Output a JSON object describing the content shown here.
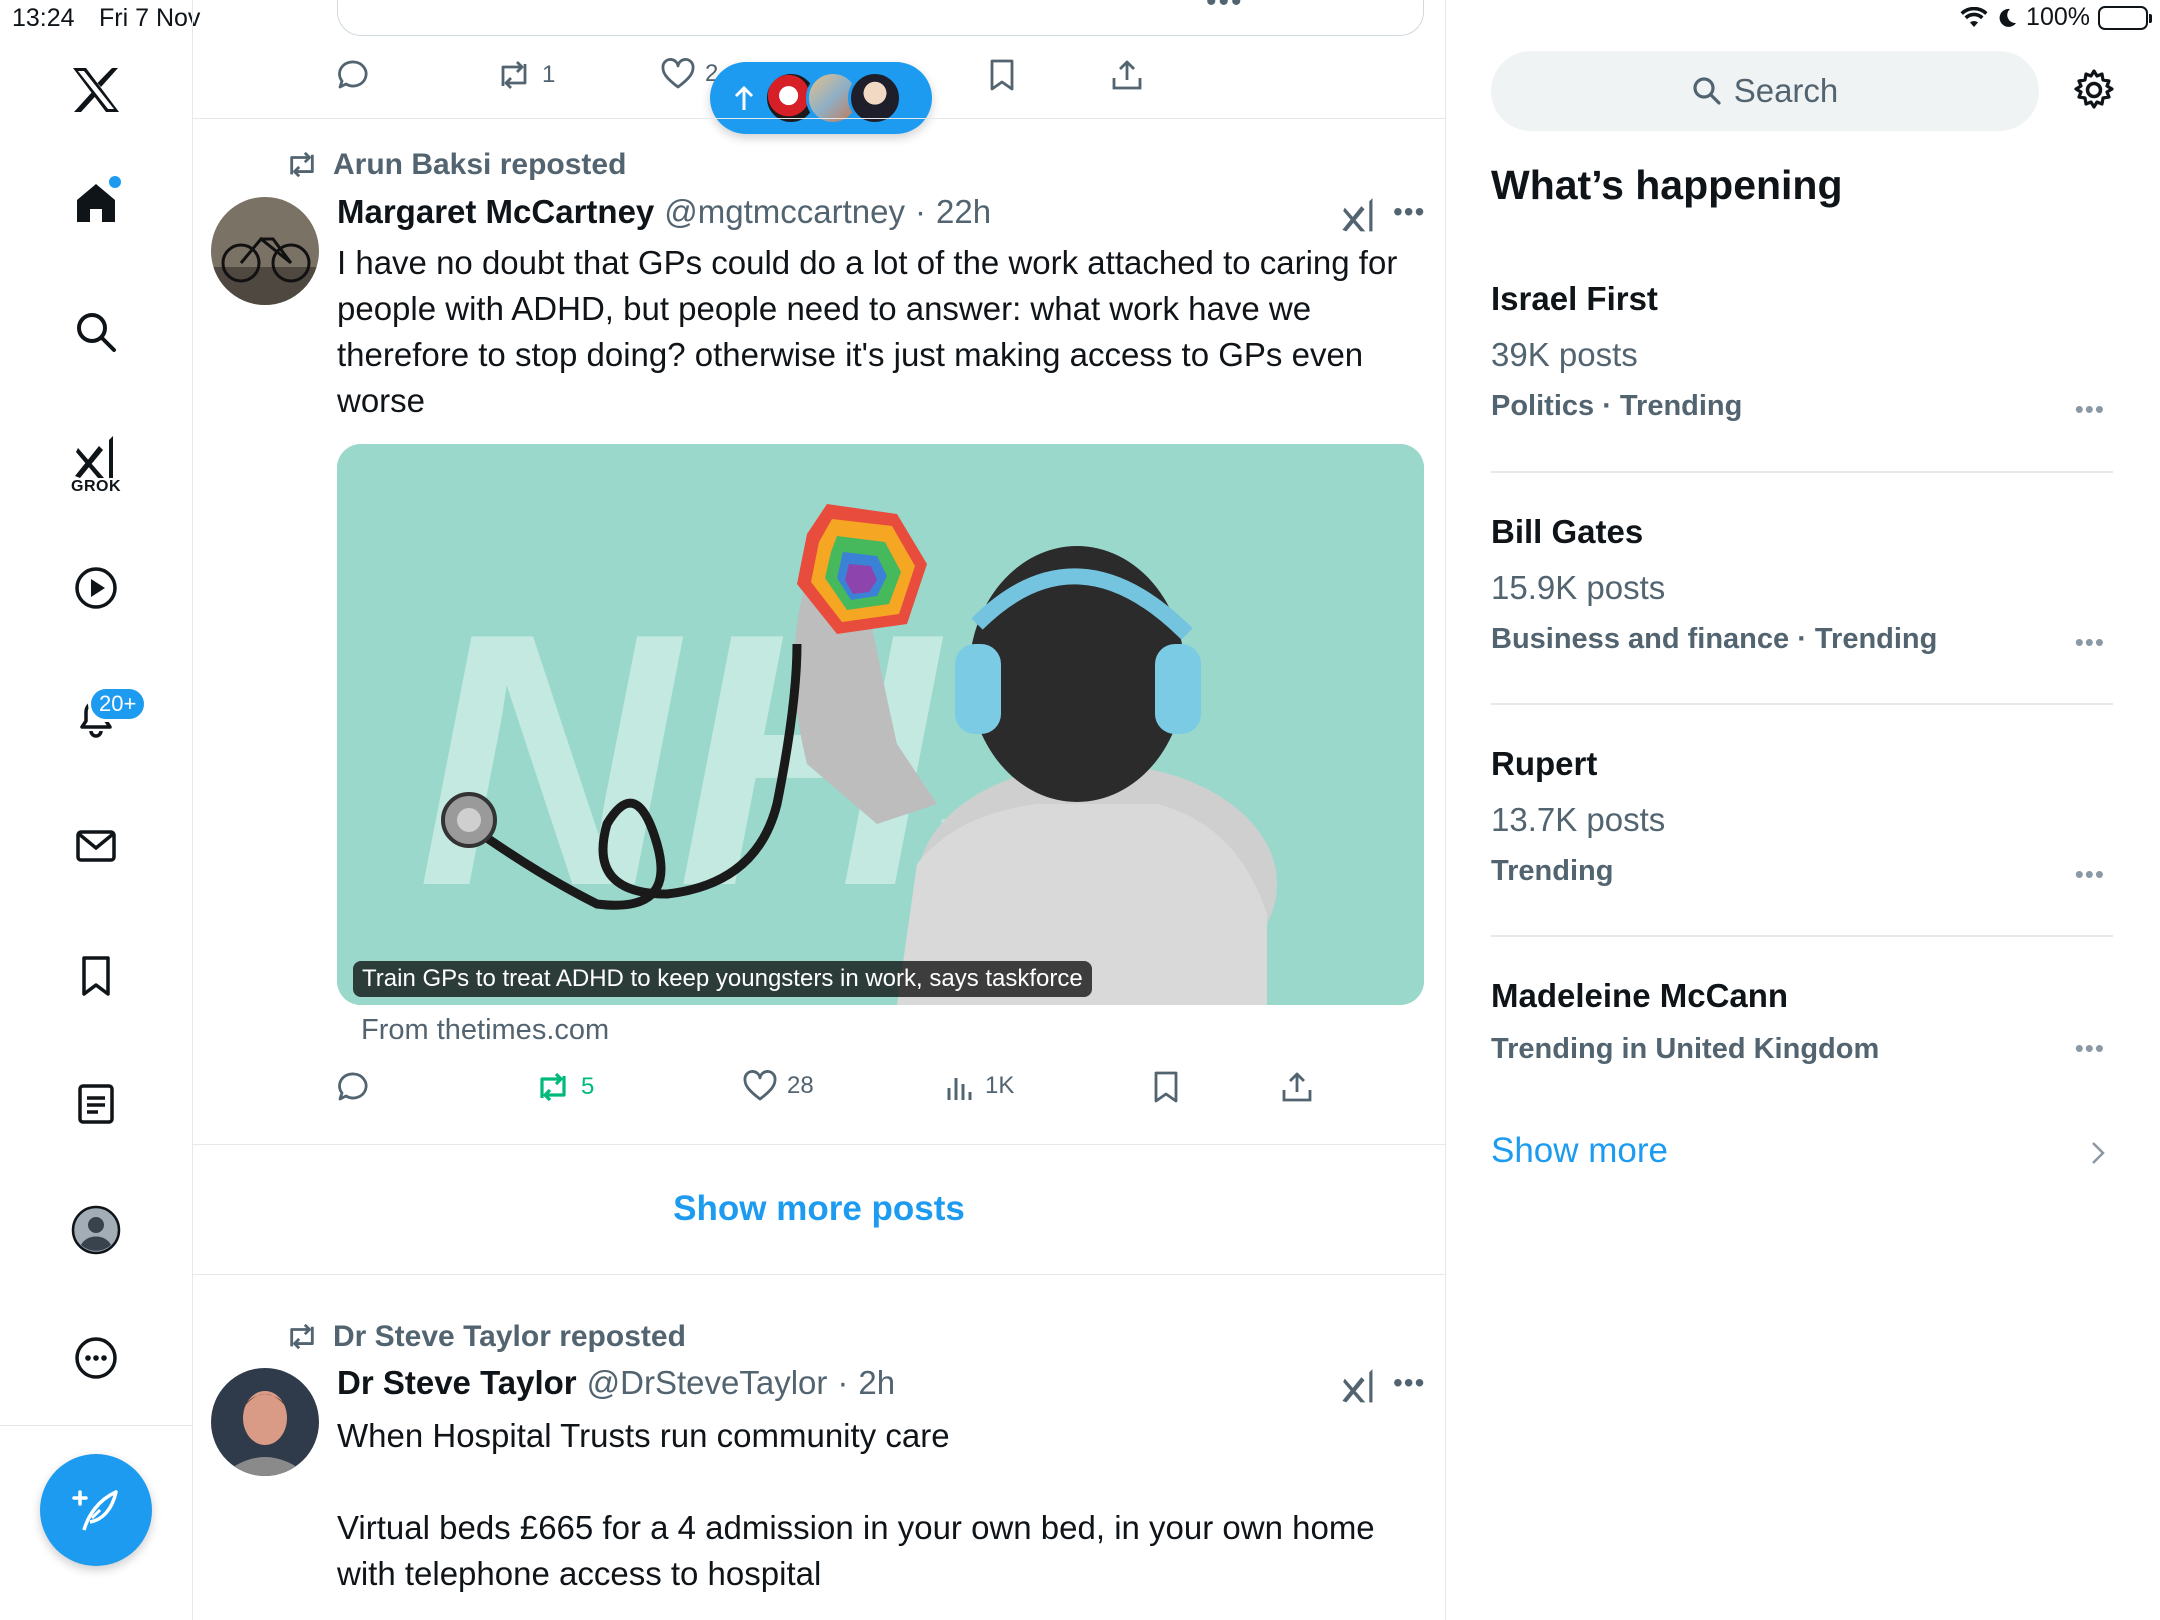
{
  "status_bar": {
    "time": "13:24",
    "date": "Fri 7 Nov",
    "battery": "100%"
  },
  "nav": {
    "grok_label": "GROK",
    "notifications_badge": "20+",
    "items": [
      "x-logo-icon",
      "home-icon",
      "search-icon",
      "grok-icon",
      "video-icon",
      "bell-icon",
      "mail-icon",
      "bookmark-icon",
      "lists-icon",
      "profile-icon",
      "more-icon",
      "compose-icon"
    ]
  },
  "top_post_actions": {
    "reply": "",
    "repost": "1",
    "like": "2"
  },
  "colors": {
    "accent": "#1d9bf0",
    "repost_green": "#00ba7c",
    "text": "#0f1419",
    "secondary": "#536471"
  },
  "posts": [
    {
      "repost_by": "Arun Baksi reposted",
      "name": "Margaret McCartney",
      "handle": "@mgtmccartney",
      "time": "22h",
      "text": "I have no doubt that GPs could do a lot of the work attached to caring for people with ADHD, but people need to answer: what work have we therefore to stop doing? otherwise it's just making access to GPs even worse",
      "media_caption": "Train GPs to treat ADHD to keep youngsters in work, says taskforce",
      "media_source": "From thetimes.com",
      "stats": {
        "reposts": "5",
        "likes": "28",
        "views": "1K"
      }
    },
    {
      "repost_by": "Dr Steve Taylor reposted",
      "name": "Dr Steve Taylor",
      "handle": "@DrSteveTaylor",
      "time": "2h",
      "text": "When Hospital Trusts run community care\n\nVirtual beds £665 for a 4 admission in your own bed, in your own home with telephone access to hospital"
    }
  ],
  "show_more_posts": "Show more posts",
  "sidebar": {
    "search_placeholder": "Search",
    "heading": "What’s happening",
    "trends": [
      {
        "name": "Israel First",
        "count": "39K posts",
        "meta": "Politics · Trending"
      },
      {
        "name": "Bill Gates",
        "count": "15.9K posts",
        "meta": "Business and finance · Trending"
      },
      {
        "name": "Rupert",
        "count": "13.7K posts",
        "meta": "Trending"
      },
      {
        "name": "Madeleine McCann",
        "count": "",
        "meta": "Trending in United Kingdom"
      }
    ],
    "show_more": "Show more"
  }
}
